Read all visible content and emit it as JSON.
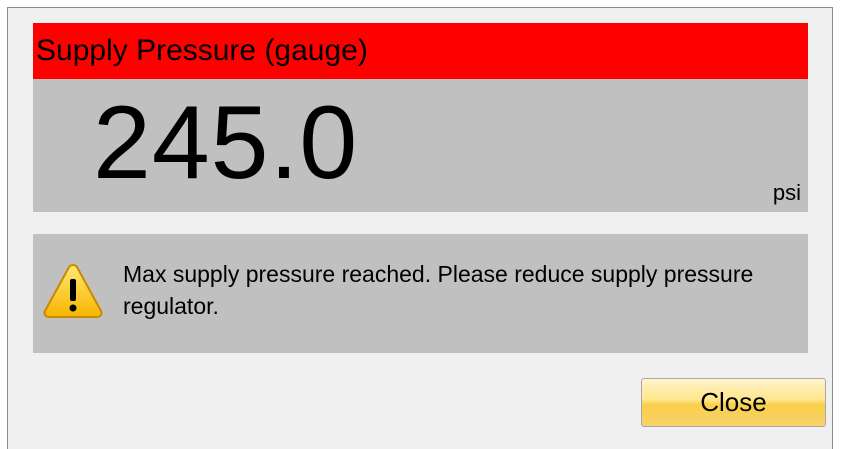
{
  "gauge": {
    "title": "Supply Pressure (gauge)",
    "value": "245.0",
    "unit": "psi",
    "header_color": "#ff0000",
    "body_color": "#c0c0c0"
  },
  "warning": {
    "icon": "warning-triangle-icon",
    "message": "Max supply pressure reached. Please reduce supply pressure regulator."
  },
  "actions": {
    "close_label": "Close"
  }
}
